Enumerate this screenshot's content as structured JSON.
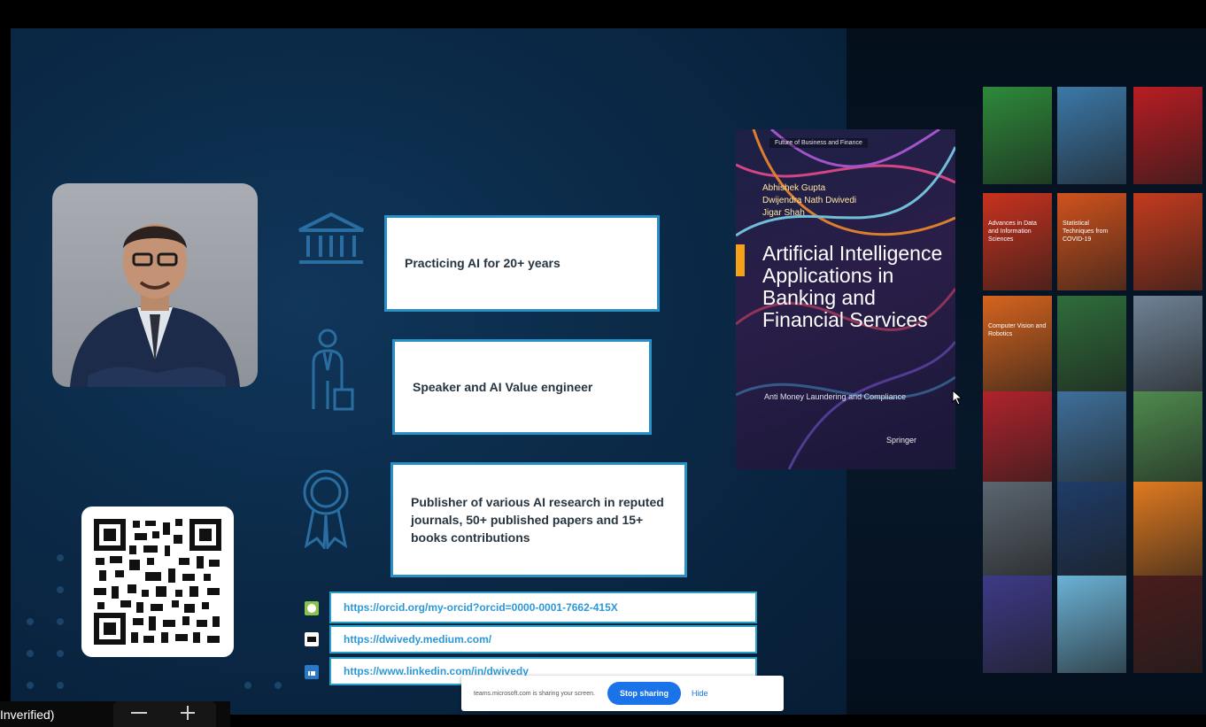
{
  "slide": {
    "info_boxes": [
      {
        "text": "Practicing AI for 20+ years",
        "icon": "bank-icon"
      },
      {
        "text": "Speaker and AI Value engineer",
        "icon": "speaker-person-icon"
      },
      {
        "text": "Publisher of various AI research in reputed journals, 50+ published papers and 15+ books contributions",
        "icon": "award-ribbon-icon"
      }
    ],
    "links": [
      {
        "url": "https://orcid.org/my-orcid?orcid=0000-0001-7662-415X",
        "icon": "orcid-icon"
      },
      {
        "url": "https://dwivedy.medium.com/",
        "icon": "medium-icon"
      },
      {
        "url": "https://www.linkedin.com/in/dwivedy",
        "icon": "linkedin-icon"
      }
    ],
    "qr_code": {
      "icon": "qr-code-icon"
    },
    "profile_photo": {
      "icon": "profile-photo"
    }
  },
  "book": {
    "series": "Future of Business and Finance",
    "authors": [
      "Abhishek Gupta",
      "Dwijendra Nath Dwivedi",
      "Jigar Shah"
    ],
    "title": "Artificial Intelligence Applications in Banking and Financial Services",
    "subtitle": "Anti Money Laundering and Compliance",
    "publisher": "Springer"
  },
  "book_grid": {
    "covers": [
      {
        "color": "#2d8a3a",
        "label": ""
      },
      {
        "color": "#3c78a8",
        "label": ""
      },
      {
        "color": "#b81d23",
        "label": ""
      },
      {
        "color": "#c8321e",
        "label": "Advances in Data and Information Sciences"
      },
      {
        "color": "#d0521d",
        "label": "Statistical Techniques from COVID-19"
      },
      {
        "color": "#c43b1e",
        "label": ""
      },
      {
        "color": "#d6641e",
        "label": "Computer Vision and Robotics"
      },
      {
        "color": "#2f6d3a",
        "label": ""
      },
      {
        "color": "#6f8296",
        "label": ""
      },
      {
        "color": "#b0232c",
        "label": ""
      },
      {
        "color": "#3f6f9a",
        "label": ""
      },
      {
        "color": "#4e8a4e",
        "label": ""
      },
      {
        "color": "#5b6670",
        "label": ""
      },
      {
        "color": "#1f3c68",
        "label": ""
      },
      {
        "color": "#e07a20",
        "label": ""
      },
      {
        "color": "#3d3a88",
        "label": ""
      },
      {
        "color": "#6bb2d6",
        "label": ""
      },
      {
        "color": "#4a1c1c",
        "label": ""
      }
    ]
  },
  "share_bar": {
    "message": "teams.microsoft.com is sharing your screen.",
    "stop_label": "Stop sharing",
    "hide_label": "Hide"
  },
  "bottom_bar": {
    "label": "Inverified)"
  }
}
